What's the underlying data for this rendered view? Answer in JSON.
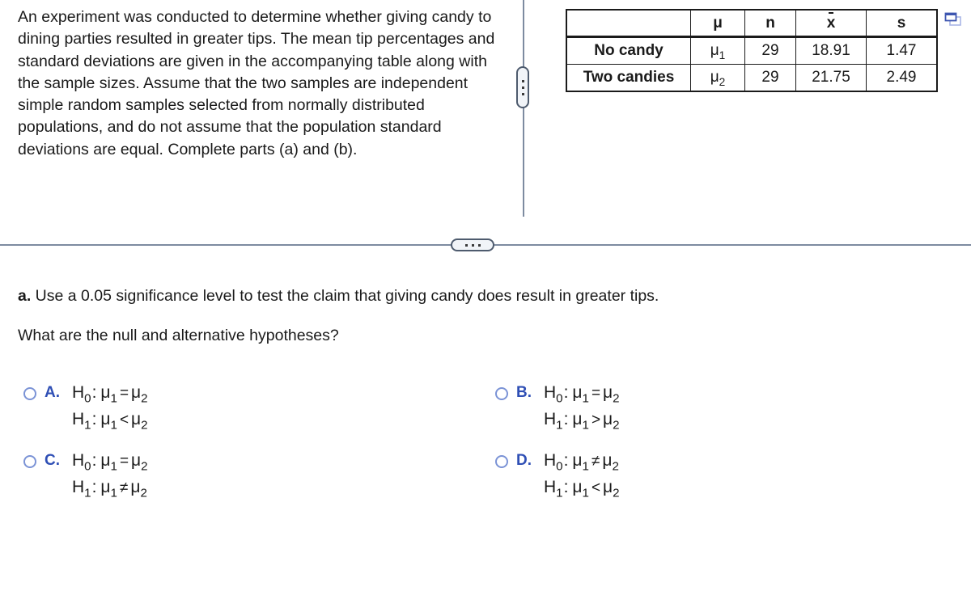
{
  "intro": {
    "text": "An experiment was conducted to determine whether giving candy to dining parties resulted in greater tips. The mean tip percentages and standard deviations are given in the accompanying table along with the sample sizes. Assume that the two samples are independent simple random samples selected from normally distributed populations, and do not assume that the population standard deviations are equal. Complete parts (a) and (b)."
  },
  "table": {
    "headers": {
      "label": "",
      "mu": "μ",
      "n": "n",
      "xbar": "x",
      "s": "s"
    },
    "rows": [
      {
        "label": "No candy",
        "mu": "μ",
        "mu_sub": "1",
        "n": "29",
        "xbar": "18.91",
        "s": "1.47"
      },
      {
        "label": "Two candies",
        "mu": "μ",
        "mu_sub": "2",
        "n": "29",
        "xbar": "21.75",
        "s": "2.49"
      }
    ]
  },
  "icons": {
    "popout": "popout-window-icon",
    "vertical_splitter": "vertical-ellipsis-handle",
    "horizontal_splitter": "horizontal-ellipsis-handle"
  },
  "question": {
    "part_label": "a.",
    "part_text": " Use a 0.05 significance level to test the claim that giving candy does result in greater tips.",
    "sub_text": "What are the null and alternative hypotheses?"
  },
  "options": [
    {
      "letter": "A.",
      "h0_rel": "=",
      "h1_rel": "<"
    },
    {
      "letter": "B.",
      "h0_rel": "=",
      "h1_rel": ">"
    },
    {
      "letter": "C.",
      "h0_rel": "=",
      "h1_rel": "≠"
    },
    {
      "letter": "D.",
      "h0_rel": "≠",
      "h1_rel": "<"
    }
  ],
  "symbols": {
    "H": "H",
    "h0_sub": "0",
    "h1_sub": "1",
    "mu": "μ",
    "sub1": "1",
    "sub2": "2",
    "colon": ":"
  },
  "colors": {
    "option_letter": "#2f4fb5",
    "radio_border": "#7b93d6",
    "splitter": "#7d8ba0"
  }
}
